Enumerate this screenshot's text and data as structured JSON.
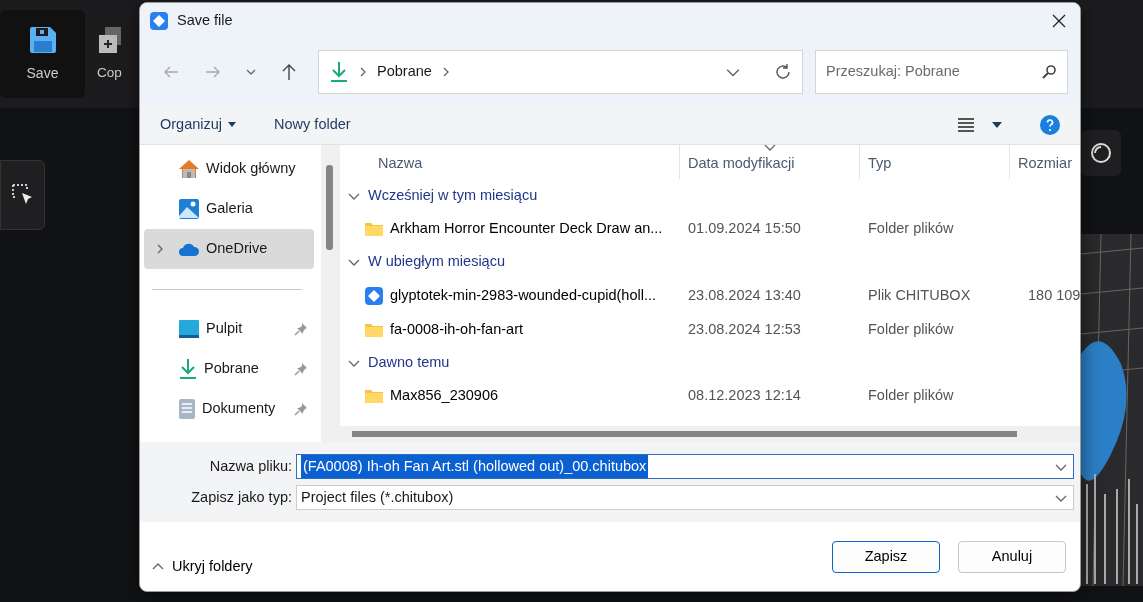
{
  "app": {
    "toolbar": [
      {
        "kind": "save",
        "label": "Save",
        "selected": true
      },
      {
        "kind": "copy",
        "label": "Cop",
        "selected": false
      }
    ]
  },
  "dialog": {
    "title": "Save file",
    "address": {
      "segments": [
        "Pobrane"
      ]
    },
    "search": {
      "placeholder": "Przeszukaj: Pobrane"
    },
    "commands": [
      {
        "label": "Organizuj",
        "dropdown": true
      },
      {
        "label": "Nowy folder",
        "dropdown": false
      }
    ],
    "sidebar": [
      {
        "kind": "home",
        "label": "Widok główny",
        "selected": false,
        "expandable": false,
        "pinned": false
      },
      {
        "kind": "gallery",
        "label": "Galeria",
        "selected": false,
        "expandable": false,
        "pinned": false
      },
      {
        "kind": "cloud",
        "label": "OneDrive",
        "selected": true,
        "expandable": true,
        "pinned": false
      },
      {
        "kind": "separator"
      },
      {
        "kind": "desktop",
        "label": "Pulpit",
        "selected": false,
        "expandable": false,
        "pinned": true
      },
      {
        "kind": "download",
        "label": "Pobrane",
        "selected": false,
        "expandable": false,
        "pinned": true
      },
      {
        "kind": "document",
        "label": "Dokumenty",
        "selected": false,
        "expandable": false,
        "pinned": true
      }
    ],
    "columns": [
      {
        "label": "Nazwa",
        "sorted": false
      },
      {
        "label": "Data modyfikacji",
        "sorted": true
      },
      {
        "label": "Typ",
        "sorted": false
      },
      {
        "label": "Rozmiar",
        "sorted": false
      }
    ],
    "groups": [
      {
        "label": "Wcześniej w tym miesiącu",
        "expanded": true,
        "rows": [
          {
            "kind": "folder",
            "name": "Arkham Horror Encounter Deck Draw an...",
            "date": "01.09.2024 15:50",
            "type": "Folder plików"
          }
        ]
      },
      {
        "label": "W ubiegłym miesiącu",
        "expanded": true,
        "rows": [
          {
            "kind": "chitubox",
            "name": "glyptotek-min-2983-wounded-cupid(holl...",
            "date": "23.08.2024 13:40",
            "type": "Plik CHITUBOX",
            "size": "180 109"
          },
          {
            "kind": "folder",
            "name": "fa-0008-ih-oh-fan-art",
            "date": "23.08.2024 12:53",
            "type": "Folder plików"
          }
        ]
      },
      {
        "label": "Dawno temu",
        "expanded": true,
        "rows": [
          {
            "kind": "folder",
            "name": "Max856_230906",
            "date": "08.12.2023 12:14",
            "type": "Folder plików"
          }
        ]
      }
    ],
    "filename": {
      "label": "Nazwa pliku:",
      "value": "(FA0008) Ih-oh Fan Art.stl (hollowed out)_00.chitubox",
      "selected": true
    },
    "filetype": {
      "label": "Zapisz jako typ:",
      "value": "Project files (*.chitubox)"
    },
    "toggle_folders": {
      "label": "Ukryj foldery",
      "expanded": true
    },
    "buttons": [
      {
        "label": "Zapisz",
        "default": true
      },
      {
        "label": "Anuluj",
        "default": false
      }
    ]
  }
}
